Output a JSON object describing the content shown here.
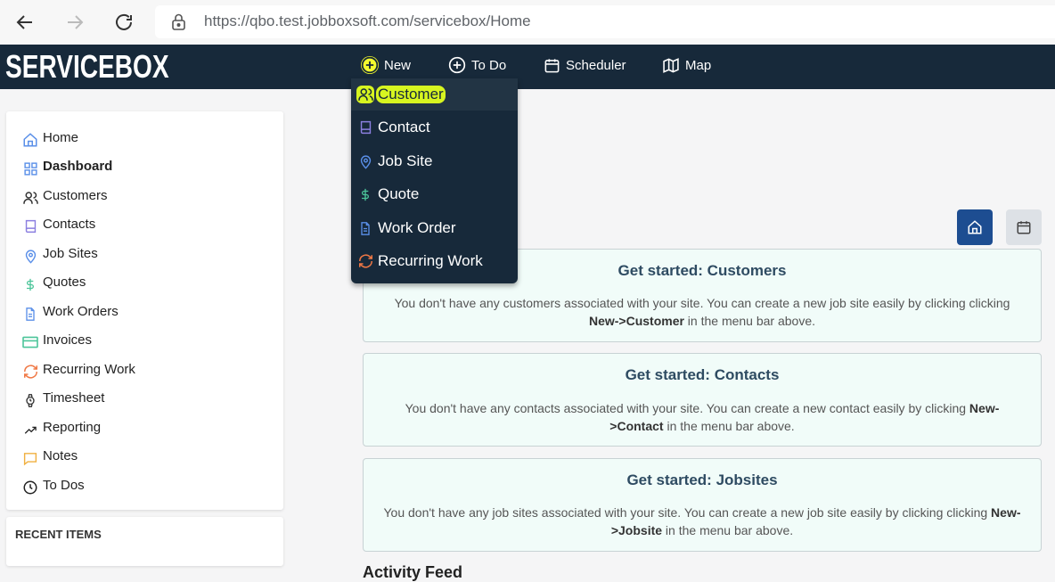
{
  "browser": {
    "url": "https://qbo.test.jobboxsoft.com/servicebox/Home"
  },
  "app": {
    "logo": "SERVICEBOX",
    "nav": [
      {
        "label": "New",
        "icon": "plus-circle-icon"
      },
      {
        "label": "To Do",
        "icon": "plus-circle-icon"
      },
      {
        "label": "Scheduler",
        "icon": "calendar-icon"
      },
      {
        "label": "Map",
        "icon": "map-icon"
      }
    ]
  },
  "new_menu": {
    "items": [
      {
        "label": "Customer",
        "icon": "users-icon",
        "color": "#e0ef3a"
      },
      {
        "label": "Contact",
        "icon": "book-icon",
        "color": "#8b7fe0"
      },
      {
        "label": "Job Site",
        "icon": "map-pin-icon",
        "color": "#5a8fe8"
      },
      {
        "label": "Quote",
        "icon": "dollar-icon",
        "color": "#4cc59a"
      },
      {
        "label": "Work Order",
        "icon": "file-text-icon",
        "color": "#5a8fe8"
      },
      {
        "label": "Recurring Work",
        "icon": "refresh-icon",
        "color": "#f07845"
      }
    ]
  },
  "sidebar": {
    "items": [
      {
        "label": "Home",
        "icon": "home-icon"
      },
      {
        "label": "Dashboard",
        "icon": "grid-icon"
      },
      {
        "label": "Customers",
        "icon": "users-icon"
      },
      {
        "label": "Contacts",
        "icon": "book-icon"
      },
      {
        "label": "Job Sites",
        "icon": "map-pin-icon"
      },
      {
        "label": "Quotes",
        "icon": "dollar-icon"
      },
      {
        "label": "Work Orders",
        "icon": "file-text-icon"
      },
      {
        "label": "Invoices",
        "icon": "credit-card-icon"
      },
      {
        "label": "Recurring Work",
        "icon": "refresh-icon"
      },
      {
        "label": "Timesheet",
        "icon": "watch-icon"
      },
      {
        "label": "Reporting",
        "icon": "trending-up-icon"
      },
      {
        "label": "Notes",
        "icon": "message-square-icon"
      },
      {
        "label": "To Dos",
        "icon": "clock-icon"
      }
    ],
    "recent_title": "RECENT ITEMS"
  },
  "cards": [
    {
      "title": "Get started: Customers",
      "text1": "You don't have any customers associated with your site. You can create a new job site easily by clicking clicking ",
      "bold": "New->Customer",
      "text2": " in the menu bar above."
    },
    {
      "title": "Get started: Contacts",
      "text1": "You don't have any contacts associated with your site. You can create a new contact easily by clicking ",
      "bold": "New->Contact",
      "text2": " in the menu bar above."
    },
    {
      "title": "Get started: Jobsites",
      "text1": "You don't have any job sites associated with your site. You can create a new job site easily by clicking clicking ",
      "bold": "New->Jobsite",
      "text2": " in the menu bar above."
    }
  ],
  "activity_title": "Activity Feed",
  "colors": {
    "header_bg": "#17293a",
    "highlight": "#d7f520",
    "primary_button": "#1d4d91",
    "card_bg": "#f1fcf9"
  }
}
